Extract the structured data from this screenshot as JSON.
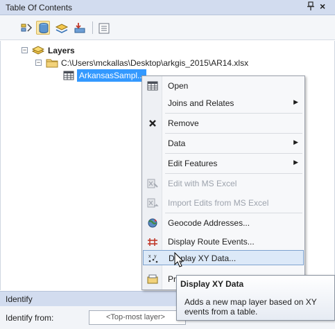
{
  "toc": {
    "title": "Table Of Contents",
    "pin_glyph": "p",
    "close_glyph": "×",
    "toolbar": [
      {
        "icon": "list-by-drawing-order-icon"
      },
      {
        "icon": "list-by-source-icon",
        "active": true
      },
      {
        "icon": "list-by-visibility-icon"
      },
      {
        "icon": "list-by-selection-icon"
      },
      {
        "icon": "options-icon"
      }
    ],
    "tree": {
      "root_label": "Layers",
      "folder_path": "C:\\Users\\mckallas\\Desktop\\arkgis_2015\\AR14.xlsx",
      "table_name": "ArkansasSampl..."
    }
  },
  "context_menu": {
    "items": [
      {
        "label": "Open",
        "icon": "table-icon"
      },
      {
        "label": "Joins and Relates",
        "submenu": true
      },
      {
        "label": "Remove",
        "icon": "remove-icon"
      },
      {
        "label": "Data",
        "submenu": true
      },
      {
        "label": "Edit Features",
        "submenu": true
      },
      {
        "label": "Edit with MS Excel",
        "disabled": true,
        "icon": "excel-edit-icon"
      },
      {
        "label": "Import Edits from MS Excel",
        "disabled": true,
        "icon": "excel-import-icon"
      },
      {
        "label": "Geocode Addresses...",
        "icon": "geocode-icon"
      },
      {
        "label": "Display Route Events...",
        "icon": "route-events-icon"
      },
      {
        "label": "Display XY Data...",
        "icon": "xy-data-icon",
        "hover": true
      },
      {
        "label": "Pr",
        "icon": "properties-icon"
      }
    ]
  },
  "tooltip": {
    "title": "Display XY Data",
    "description": "Adds a new map layer based on XY events from a table."
  },
  "identify": {
    "title": "Identify",
    "from_label": "Identify from:",
    "from_value": "<Top-most layer>"
  },
  "colors": {
    "titlebar": "#d2dcef",
    "selection": "#3399ff",
    "menu_hover": "#dce9f8"
  }
}
